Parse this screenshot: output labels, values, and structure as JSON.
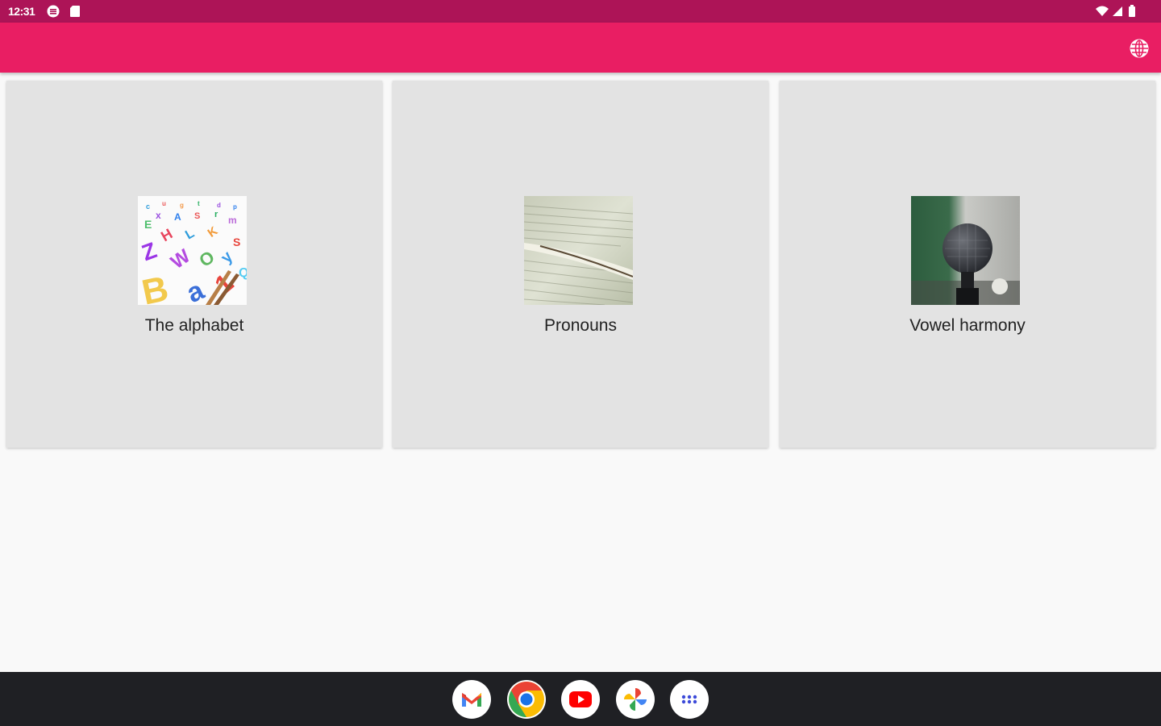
{
  "status_bar": {
    "time": "12:31",
    "icons": [
      "settings-circle-icon",
      "sd-card-icon",
      "wifi-icon",
      "signal-icon",
      "battery-icon"
    ]
  },
  "app_bar": {
    "actions": [
      "language-globe-icon"
    ],
    "color": "#e91e63",
    "status_color": "#ad1457"
  },
  "topics": [
    {
      "label": "The alphabet",
      "image": "colorful-letters-image"
    },
    {
      "label": "Pronouns",
      "image": "open-book-image"
    },
    {
      "label": "Vowel harmony",
      "image": "microphone-image"
    }
  ],
  "taskbar": {
    "apps": [
      "gmail-icon",
      "chrome-icon",
      "youtube-icon",
      "photos-icon",
      "app-drawer-icon"
    ]
  }
}
